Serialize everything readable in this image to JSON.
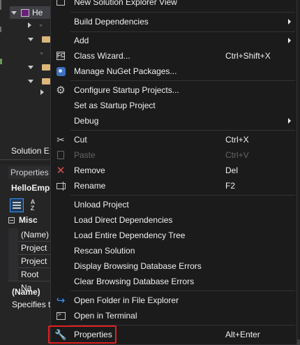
{
  "solution_explorer": {
    "label": "Solution E",
    "project_label": "He"
  },
  "properties_panel": {
    "title": "Properties",
    "object_name": "HelloEmp",
    "category": "Misc",
    "rows": [
      "(Name)",
      "Project",
      "Project",
      "Root Na"
    ],
    "description_title": "(Name)",
    "description_text": "Specifies t"
  },
  "context_menu": {
    "items": [
      {
        "label": "New Solution Explorer View",
        "icon": "view-icon"
      },
      {
        "label": "Build Dependencies",
        "submenu": true
      },
      {
        "label": "Add",
        "submenu": true
      },
      {
        "label": "Class Wizard...",
        "shortcut": "Ctrl+Shift+X",
        "icon": "class-wizard-icon"
      },
      {
        "label": "Manage NuGet Packages...",
        "icon": "nuget-icon"
      },
      {
        "label": "Configure Startup Projects...",
        "icon": "gear-icon"
      },
      {
        "label": "Set as Startup Project"
      },
      {
        "label": "Debug",
        "submenu": true
      },
      {
        "label": "Cut",
        "shortcut": "Ctrl+X",
        "icon": "scissors-icon"
      },
      {
        "label": "Paste",
        "shortcut": "Ctrl+V",
        "icon": "paste-icon",
        "disabled": true
      },
      {
        "label": "Remove",
        "shortcut": "Del",
        "icon": "remove-x-icon"
      },
      {
        "label": "Rename",
        "shortcut": "F2",
        "icon": "rename-icon"
      },
      {
        "label": "Unload Project"
      },
      {
        "label": "Load Direct Dependencies"
      },
      {
        "label": "Load Entire Dependency Tree"
      },
      {
        "label": "Rescan Solution"
      },
      {
        "label": "Display Browsing Database Errors"
      },
      {
        "label": "Clear Browsing Database Errors"
      },
      {
        "label": "Open Folder in File Explorer",
        "icon": "open-folder-icon"
      },
      {
        "label": "Open in Terminal",
        "icon": "terminal-icon"
      },
      {
        "label": "Properties",
        "shortcut": "Alt+Enter",
        "icon": "wrench-icon",
        "highlighted": true
      }
    ]
  },
  "colors": {
    "menu_bg": "#1b1b1c",
    "text": "#f1f1f1",
    "disabled_text": "#656565",
    "highlight_border": "#e02020",
    "remove_icon": "#e05252"
  }
}
